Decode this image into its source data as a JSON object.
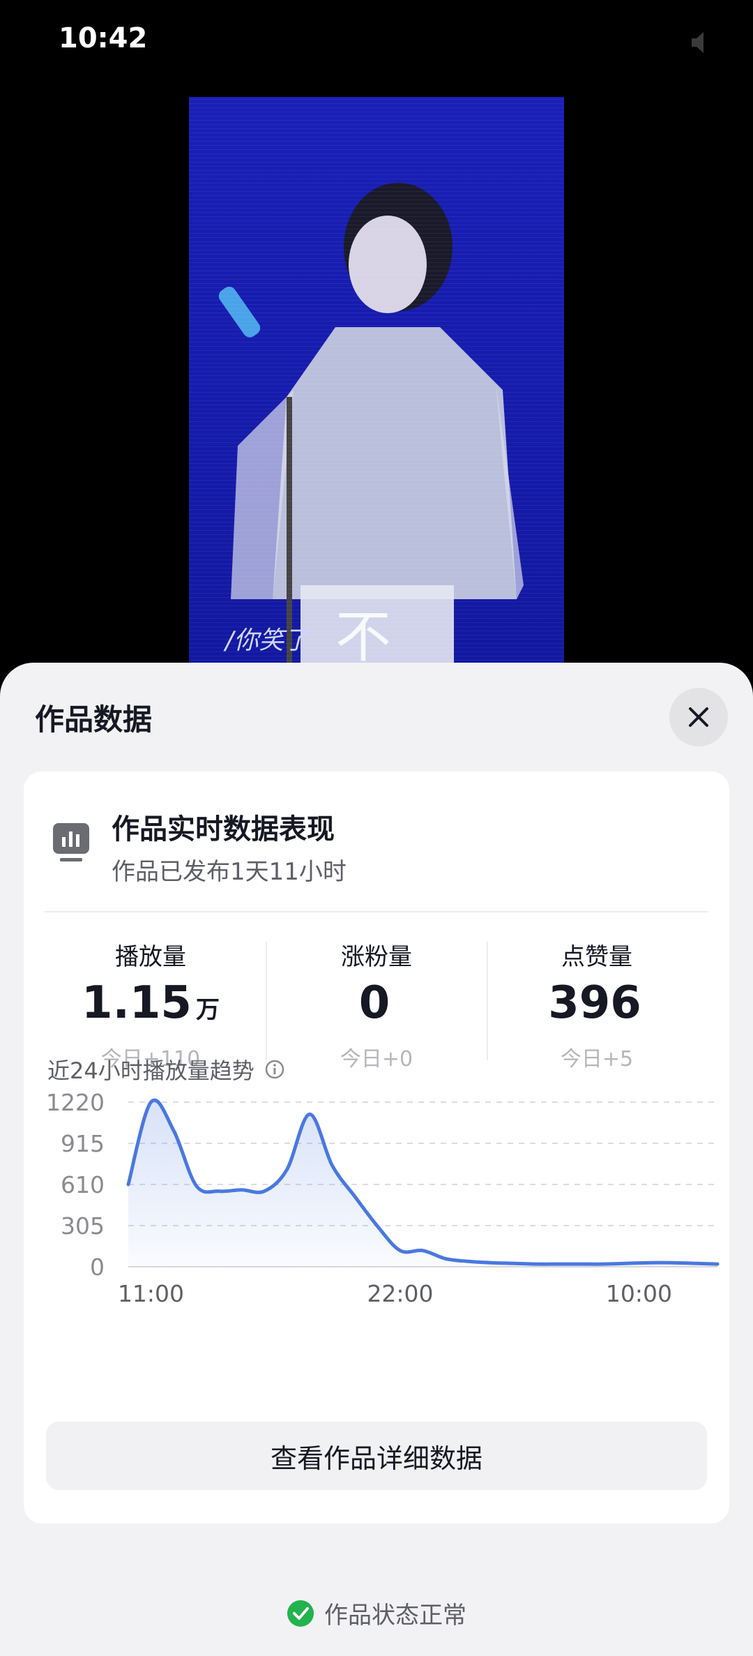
{
  "status_bar": {
    "time": "10:42"
  },
  "video": {
    "lyric_small": "/你笑了",
    "lyric_large": "不"
  },
  "sheet": {
    "title": "作品数据",
    "card": {
      "heading": "作品实时数据表现",
      "subtitle": "作品已发布1天11小时",
      "metrics": [
        {
          "label": "播放量",
          "value": "1.15",
          "unit": "万",
          "delta": "今日+110"
        },
        {
          "label": "涨粉量",
          "value": "0",
          "unit": "",
          "delta": "今日+0"
        },
        {
          "label": "点赞量",
          "value": "396",
          "unit": "",
          "delta": "今日+5"
        }
      ],
      "chart_title": "近24小时播放量趋势",
      "detail_button": "查看作品详细数据"
    },
    "status": "作品状态正常"
  },
  "colors": {
    "accent": "#4a78e0",
    "success": "#22b34f",
    "sheet_bg": "#f2f2f4"
  },
  "chart_data": {
    "type": "area",
    "title": "近24小时播放量趋势",
    "y_ticks": [
      "1220",
      "915",
      "610",
      "305",
      "0"
    ],
    "ylim": [
      0,
      1220
    ],
    "x_tick_labels": [
      "11:00",
      "22:00",
      "10:00"
    ],
    "x_tick_hours": [
      1,
      12,
      24
    ],
    "x": [
      0,
      1,
      2,
      3,
      4,
      5,
      6,
      7,
      8,
      9,
      10,
      11,
      12,
      13,
      14,
      15,
      16,
      17,
      18,
      19,
      20,
      21,
      22,
      23,
      24,
      25,
      26
    ],
    "values": [
      610,
      1220,
      1010,
      600,
      560,
      570,
      560,
      720,
      1130,
      750,
      520,
      300,
      120,
      120,
      60,
      40,
      30,
      25,
      20,
      20,
      20,
      20,
      25,
      30,
      30,
      25,
      20
    ],
    "grid": true,
    "legend": "none"
  }
}
